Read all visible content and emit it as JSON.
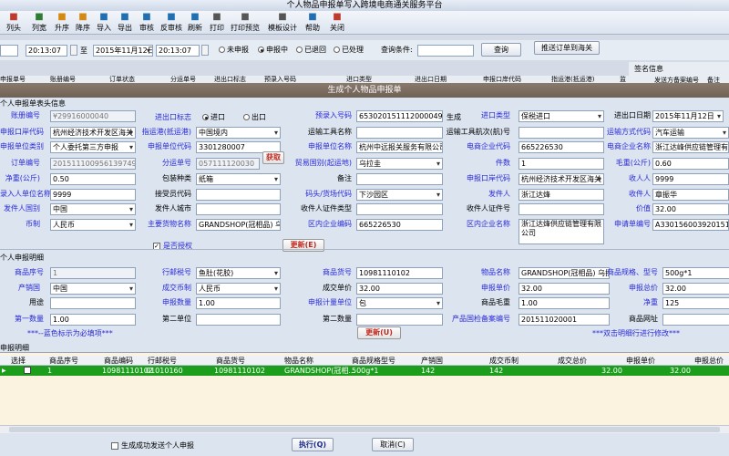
{
  "window": {
    "title": "个人物品申报单写入跨境电商通关服务平台"
  },
  "toolbar": [
    {
      "label": "列头",
      "icon": "columns-icon",
      "color": "#c0392b"
    },
    {
      "label": "列宽",
      "icon": "column-width-icon",
      "color": "#2e7d32"
    },
    {
      "label": "升序",
      "icon": "sort-asc-icon",
      "color": "#d68910"
    },
    {
      "label": "降序",
      "icon": "sort-desc-icon",
      "color": "#d68910"
    },
    {
      "label": "导入",
      "icon": "import-icon",
      "color": "#1f6fb2"
    },
    {
      "label": "导出",
      "icon": "export-icon",
      "color": "#1f6fb2"
    },
    {
      "label": "审核",
      "icon": "audit-icon",
      "color": "#1f6fb2"
    },
    {
      "label": "反审核",
      "icon": "unaudit-icon",
      "color": "#1f6fb2"
    },
    {
      "label": "刷新",
      "icon": "refresh-icon",
      "color": "#1f6fb2"
    },
    {
      "label": "打印",
      "icon": "print-icon",
      "color": "#555555"
    },
    {
      "label": "打印预览",
      "icon": "print-preview-icon",
      "color": "#555555"
    },
    {
      "label": "模板设计",
      "icon": "template-design-icon",
      "color": "#555555"
    },
    {
      "label": "帮助",
      "icon": "help-icon",
      "color": "#1f6fb2"
    },
    {
      "label": "关闭",
      "icon": "close-icon",
      "color": "#c0392b"
    }
  ],
  "filter": {
    "time_from": "20:13:07",
    "date_to": "2015年11月12日",
    "time_to": "20:13:07",
    "status_options": [
      {
        "label": "未申报",
        "selected": false
      },
      {
        "label": "申报中",
        "selected": true
      },
      {
        "label": "已退回",
        "selected": false
      },
      {
        "label": "已处理",
        "selected": false
      }
    ],
    "query_label": "查询条件:",
    "query_value": "",
    "search_button": "查询",
    "send_button": "推送订单到海关"
  },
  "background_list": {
    "columns": [
      "申报单号",
      "账册编号",
      "订单状态",
      "分运单号",
      "进出口标志",
      "预录入号码",
      "进口类型",
      "进出口日期",
      "申报口岸代码",
      "指运港(抵运港)",
      "监"
    ],
    "sign_info_label": "签名信息",
    "sign_columns": [
      "发送方备案编号",
      "备注"
    ]
  },
  "dialog": {
    "title": "生成个人物品申报单",
    "header_section": "个人申报单表头信息",
    "fields": {
      "account_no": {
        "label": "账册编号",
        "value": "¥29916000040"
      },
      "io_flag": {
        "label": "进出口标志",
        "options": [
          "进口",
          "出口"
        ],
        "selected": "进口"
      },
      "pre_entry_no": {
        "label": "预录入号码",
        "value": "653020151112000049"
      },
      "generate_label": "生成",
      "import_type": {
        "label": "进口类型",
        "value": "保税进口"
      },
      "io_date": {
        "label": "进出口日期",
        "value": "2015年11月12日"
      },
      "port_code": {
        "label": "申报口岸代码",
        "value": "杭州经济技术开发区海关"
      },
      "dest_port": {
        "label": "指运港(抵运港)",
        "value": "中国境内"
      },
      "transport_name": {
        "label": "运输工具名称",
        "value": ""
      },
      "transport_voyage": {
        "label": "运输工具航次(航)号",
        "value": ""
      },
      "transport_mode": {
        "label": "运输方式代码",
        "value": "汽车运输"
      },
      "declare_type": {
        "label": "申报单位类别",
        "value": "个人委托第三方申报"
      },
      "declare_unit_code": {
        "label": "申报单位代码",
        "value": "3301280007"
      },
      "declare_unit_name": {
        "label": "申报单位名称",
        "value": "杭州中远报关服务有限公司"
      },
      "ecommerce_code": {
        "label": "电商企业代码",
        "value": "665226530"
      },
      "ecommerce_name": {
        "label": "电商企业名称",
        "value": "浙江达峰供应链管理有限"
      },
      "order_no": {
        "label": "订单编号",
        "value": "20151110095613974981"
      },
      "waybill_no": {
        "label": "分运单号",
        "value": "057111120030"
      },
      "fetch_button": "获取",
      "trade_country": {
        "label": "贸易国别(起运地)",
        "value": "乌拉圭"
      },
      "pieces": {
        "label": "件数",
        "value": "1"
      },
      "gross_weight": {
        "label": "毛重(公斤)",
        "value": "0.60"
      },
      "net_weight": {
        "label": "净重(公斤)",
        "value": "0.50"
      },
      "packing_type": {
        "label": "包装种类",
        "value": "纸箱"
      },
      "remark": {
        "label": "备注",
        "value": ""
      },
      "declare_port_code": {
        "label": "申报口岸代码",
        "value": "杭州经济技术开发区海关"
      },
      "recipient": {
        "label": "收人人",
        "value": "9999"
      },
      "entry_person": {
        "label": "录入人单位名称",
        "value": "9999"
      },
      "receiver_name": {
        "label": "接受员代码",
        "value": ""
      },
      "port_dock": {
        "label": "码头/货场代码",
        "value": "下沙园区"
      },
      "sender": {
        "label": "发件人",
        "value": "浙江达烽"
      },
      "receiver": {
        "label": "收件人",
        "value": "章振华"
      },
      "sender_country": {
        "label": "发件人国别",
        "value": "中国"
      },
      "sender_city": {
        "label": "发件人城市",
        "value": ""
      },
      "recipient_id_type": {
        "label": "收件人证件类型",
        "value": ""
      },
      "recipient_id_no": {
        "label": "收件人证件号",
        "value": ""
      },
      "price": {
        "label": "价值",
        "value": "32.00"
      },
      "currency": {
        "label": "币制",
        "value": "人民币"
      },
      "main_goods": {
        "label": "主要货物名称",
        "value": "GRANDSHOP(冠相品) 乌拉圭"
      },
      "region_ecommerce_code": {
        "label": "区内企业编码",
        "value": "665226530"
      },
      "region_ecommerce_name": {
        "label": "区内企业名称",
        "value": "浙江达烽供应链管理有限公司"
      },
      "declare_order_no": {
        "label": "申请单编号",
        "value": "A330156003920151100"
      },
      "authorized": {
        "label": "是否授权",
        "checked": true
      },
      "update_button": "更新(E)"
    },
    "detail_section": "个人申报明细",
    "detail": {
      "item_no": {
        "label": "商品序号",
        "value": "1"
      },
      "hs_code": {
        "label": "行邮税号",
        "value": "鱼肚(花胶)"
      },
      "goods_code": {
        "label": "商品货号",
        "value": "10981110102"
      },
      "goods_name": {
        "label": "物品名称",
        "value": "GRANDSHOP(冠相品) 乌拉圭"
      },
      "goods_spec": {
        "label": "商品规格、型号",
        "value": "500g*1"
      },
      "origin": {
        "label": "产销国",
        "value": "中国"
      },
      "deal_currency": {
        "label": "成交币制",
        "value": "人民币"
      },
      "deal_price": {
        "label": "成交单价",
        "value": "32.00"
      },
      "declare_price": {
        "label": "申报单价",
        "value": "32.00"
      },
      "declare_total": {
        "label": "申报总价",
        "value": "32.00"
      },
      "usage": {
        "label": "用途",
        "value": ""
      },
      "declare_qty": {
        "label": "申报数量",
        "value": "1.00"
      },
      "declare_unit": {
        "label": "申报计量单位",
        "value": "包"
      },
      "net_weight": {
        "label": "商品毛重",
        "value": "1.00"
      },
      "net_gross": {
        "label": "净重",
        "value": "125"
      },
      "first_qty": {
        "label": "第一数量",
        "value": "1.00"
      },
      "second_unit": {
        "label": "第二单位",
        "value": ""
      },
      "second_qty": {
        "label": "第二数量",
        "value": ""
      },
      "inspection_no": {
        "label": "产品国检备案编号",
        "value": "201511020001"
      },
      "goods_url": {
        "label": "商品网址",
        "value": ""
      },
      "note_left": "***--蓝色标示为必填项***",
      "update_button": "更新(U)",
      "note_right": "***双击明细行进行修改***"
    },
    "grid_section": "申报明细",
    "grid": {
      "columns": [
        "选择",
        "商品序号",
        "商品编码",
        "行邮税号",
        "商品货号",
        "物品名称",
        "商品规格型号",
        "产销国",
        "成交币制",
        "成交总价",
        "申报单价",
        "申报总价"
      ],
      "rows": [
        {
          "sel": "",
          "item_no": "1",
          "goods_code": "10981110102",
          "hs_code": "01010160",
          "goods_no": "10981110102",
          "name": "GRANDSHOP(冠相...",
          "spec": "500g*1",
          "origin": "142",
          "currency": "142",
          "deal_total": "32.00",
          "unit_price": "32.00",
          "total": ""
        }
      ]
    },
    "footer": {
      "send_check_label": "生成成功发送个人申报",
      "execute_button": "执行(Q)",
      "cancel_button": "取消(C)"
    }
  }
}
